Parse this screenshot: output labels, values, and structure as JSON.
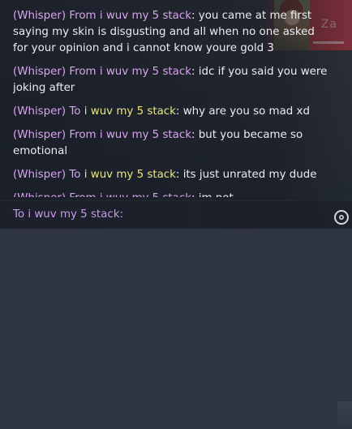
{
  "agent_card": {
    "name": "Za"
  },
  "chat": {
    "messages": [
      {
        "prefix": "(Whisper)",
        "direction": "From",
        "partner": "i wuv my 5 stack",
        "text": "you came at me first saying my skin is disgusting and all when no one asked for your opinion and i cannot know youre gold 3",
        "outgoing": false
      },
      {
        "prefix": "(Whisper)",
        "direction": "From",
        "partner": "i wuv my 5 stack",
        "text": "idc if you said you were joking after",
        "outgoing": false
      },
      {
        "prefix": "(Whisper)",
        "direction": "To",
        "partner": "i wuv my 5 stack",
        "text": "why are you so mad xd",
        "outgoing": true
      },
      {
        "prefix": "(Whisper)",
        "direction": "From",
        "partner": "i wuv my 5 stack",
        "text": "but you became so emotional",
        "outgoing": false
      },
      {
        "prefix": "(Whisper)",
        "direction": "To",
        "partner": "i wuv my 5 stack",
        "text": "its just unrated my dude",
        "outgoing": true
      },
      {
        "prefix": "(Whisper)",
        "direction": "From",
        "partner": "i wuv my 5 stack",
        "text": "im not",
        "outgoing": false
      }
    ],
    "input": {
      "label": "To i wuv my 5 stack:",
      "value": "",
      "placeholder": ""
    }
  },
  "icons": {
    "settings": "settings-icon"
  },
  "colors": {
    "whisper": "#d9a4f0",
    "outgoing_partner": "#e8e87a",
    "message_text": "#e9eef2"
  }
}
